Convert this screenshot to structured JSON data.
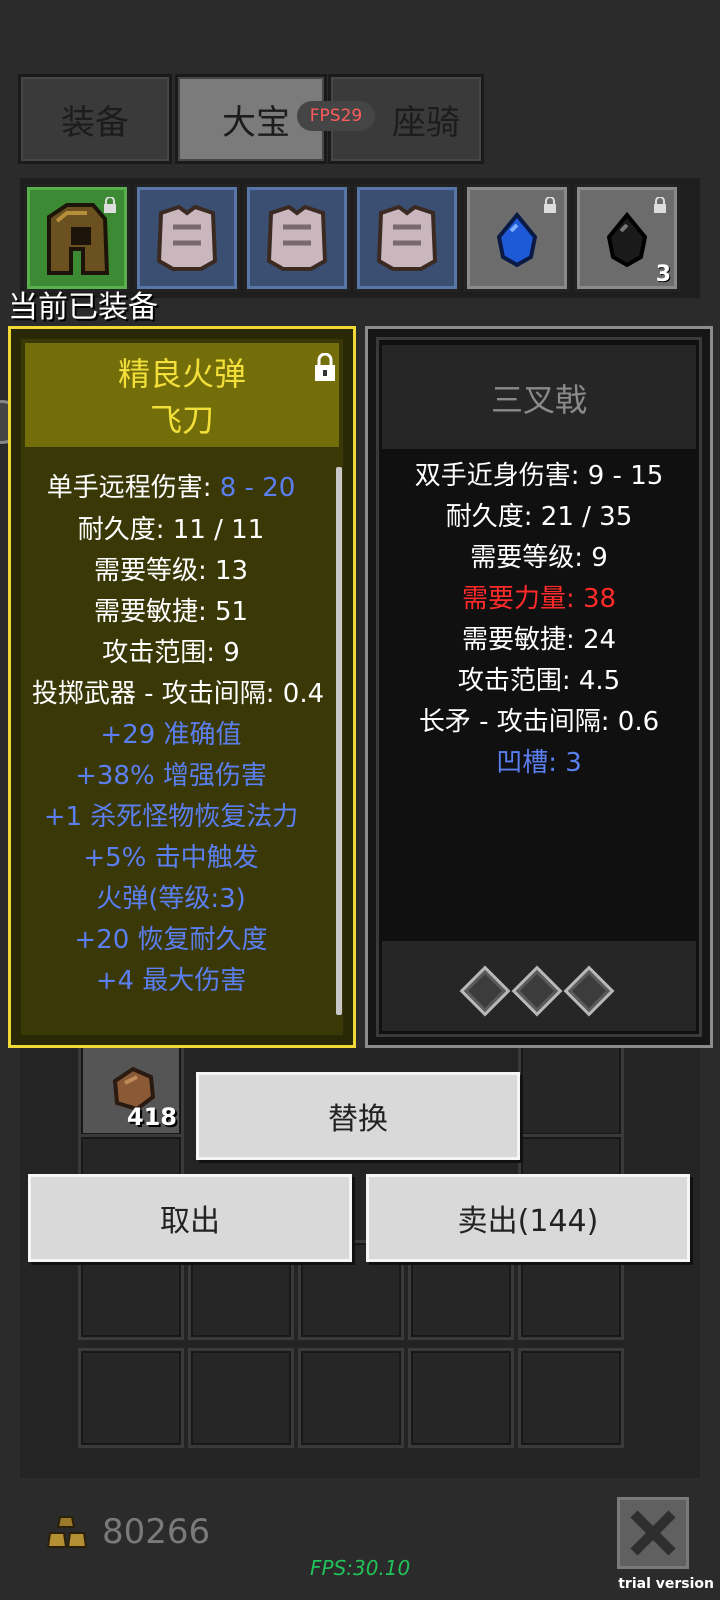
{
  "tabs": [
    {
      "label": "装备",
      "active": false
    },
    {
      "label": "大宝",
      "active": true
    },
    {
      "label": "座骑",
      "active": false
    }
  ],
  "fps_badge": "FPS29",
  "equipped_label": "当前已装备",
  "slots": [
    {
      "icon": "helmet-icon",
      "color": "green",
      "locked": true,
      "count": ""
    },
    {
      "icon": "armor-icon",
      "color": "blue",
      "locked": false,
      "count": ""
    },
    {
      "icon": "armor-icon",
      "color": "blue",
      "locked": false,
      "count": ""
    },
    {
      "icon": "armor-icon",
      "color": "blue",
      "locked": false,
      "count": ""
    },
    {
      "icon": "blue-gem-icon",
      "color": "gray",
      "locked": true,
      "count": ""
    },
    {
      "icon": "black-gem-icon",
      "color": "gray",
      "locked": true,
      "count": "3"
    }
  ],
  "left_item": {
    "title_line1": "精良火弹",
    "title_line2": "飞刀",
    "stats": [
      {
        "text_a": "单手远程伤害: ",
        "text_b": "8 - 20"
      },
      {
        "text": "耐久度: 11 / 11",
        "color": "white"
      },
      {
        "text": "需要等级: 13",
        "color": "white"
      },
      {
        "text": "需要敏捷: 51",
        "color": "white"
      },
      {
        "text": "攻击范围: 9",
        "color": "white"
      },
      {
        "text": "投掷武器 - 攻击间隔: 0.4",
        "color": "white"
      },
      {
        "text": "+29 准确值",
        "color": "blue"
      },
      {
        "text": "+38% 增强伤害",
        "color": "blue"
      },
      {
        "text": "+1 杀死怪物恢复法力",
        "color": "blue"
      },
      {
        "text": "+5% 击中触发",
        "color": "blue"
      },
      {
        "text": "火弹(等级:3)",
        "color": "blue"
      },
      {
        "text": "+20 恢复耐久度",
        "color": "blue"
      },
      {
        "text": "+4 最大伤害",
        "color": "blue"
      }
    ]
  },
  "right_item": {
    "title": "三叉戟",
    "stats": [
      {
        "text": "双手近身伤害: 9 - 15",
        "color": "white"
      },
      {
        "text": "耐久度: 21 / 35",
        "color": "white"
      },
      {
        "text": "需要等级: 9",
        "color": "white"
      },
      {
        "text": "需要力量: 38",
        "color": "red"
      },
      {
        "text": "需要敏捷: 24",
        "color": "white"
      },
      {
        "text": "攻击范围: 4.5",
        "color": "white"
      },
      {
        "text": "长矛 - 攻击间隔: 0.6",
        "color": "white"
      },
      {
        "text": "凹槽: 3",
        "color": "blue"
      }
    ],
    "sockets": 3
  },
  "inventory_item": {
    "icon": "ore-icon",
    "count": "418"
  },
  "buttons": {
    "replace": "替换",
    "take_out": "取出",
    "sell": "卖出(144)"
  },
  "gold": {
    "icon": "gold-icon",
    "amount": "80266"
  },
  "fps_text": "FPS:30.10",
  "trial_text": "trial version",
  "colors": {
    "left_border": "#f0d836",
    "left_title": "#f3df3a",
    "stat_blue": "#5b7ff0",
    "stat_red": "#ff2a2a",
    "fps_green": "#22c25a"
  }
}
